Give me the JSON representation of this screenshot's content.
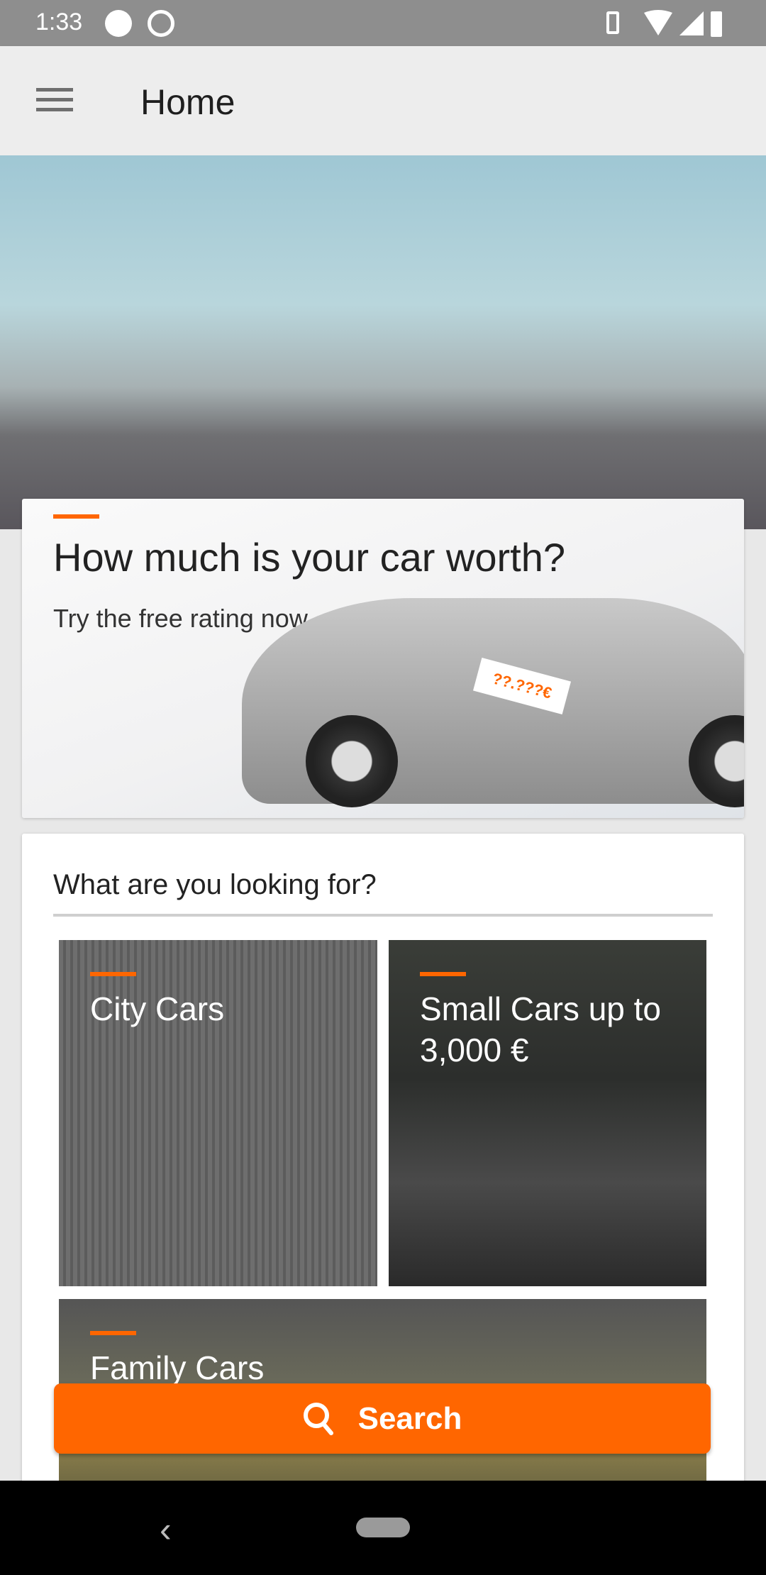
{
  "status_bar": {
    "time": "1:33"
  },
  "app_bar": {
    "title": "Home",
    "menu_icon": "hamburger-icon"
  },
  "promo": {
    "title": "How much is your car worth?",
    "subtitle": "Try the free rating now.",
    "price_tag": "??.???€"
  },
  "categories": {
    "title": "What are you looking for?",
    "items": [
      {
        "label": "City Cars"
      },
      {
        "label": "Small Cars up to 3,000 €"
      },
      {
        "label": "Family Cars"
      }
    ]
  },
  "search_button": {
    "label": "Search",
    "icon": "search-icon"
  },
  "colors": {
    "accent": "#ff6600"
  }
}
